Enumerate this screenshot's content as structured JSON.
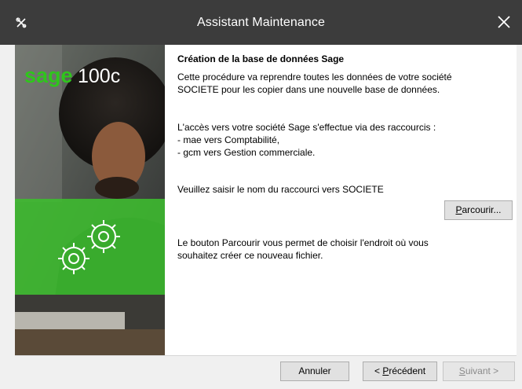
{
  "window": {
    "title": "Assistant Maintenance",
    "app_icon": "tools-icon",
    "close_icon": "close-icon"
  },
  "banner": {
    "brand": "sage",
    "product": "100c",
    "brand_color": "#2fc51c",
    "overlay_color": "#3dbd2f",
    "gears_icon": "gears-icon"
  },
  "content": {
    "heading": "Création de la base de données Sage",
    "para1": "Cette procédure va reprendre toutes les données de votre société\nSOCIETE pour les copier dans une nouvelle base de données.",
    "para2": "L'accès vers votre société Sage s'effectue via des raccourcis :\n- mae vers Comptabilité,\n- gcm vers Gestion commerciale.",
    "para3": "Veuillez saisir le nom du raccourci vers SOCIETE",
    "browse_button": {
      "underlined": "P",
      "rest": "arcourir..."
    },
    "para4": "Le bouton Parcourir vous permet de choisir l'endroit où vous\nsouhaitez créer ce nouveau fichier."
  },
  "footer": {
    "cancel": "Annuler",
    "previous": {
      "prefix": "< ",
      "underlined": "P",
      "rest": "récédent"
    },
    "next": {
      "underlined": "S",
      "rest": "uivant >"
    }
  }
}
